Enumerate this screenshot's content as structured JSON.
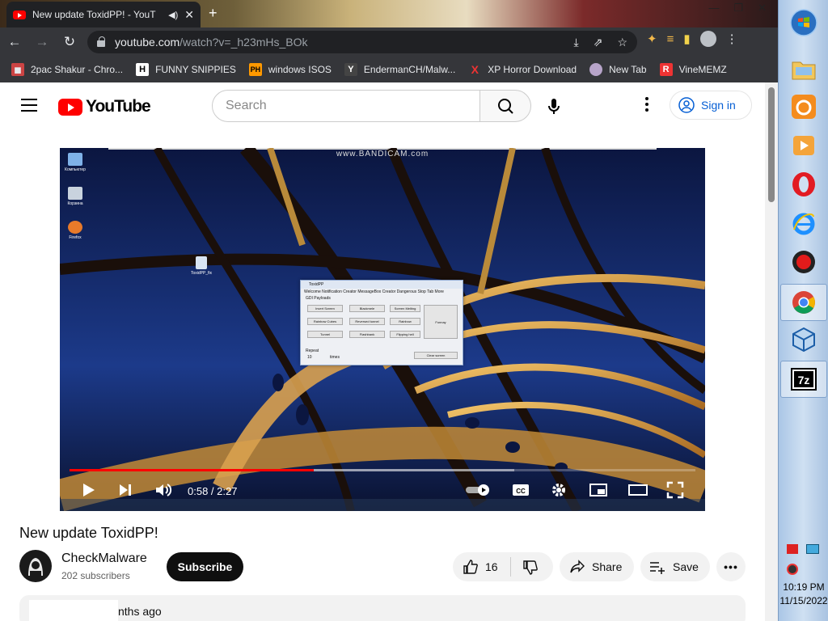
{
  "tab": {
    "title": "New update ToxidPP! - YouT"
  },
  "address": {
    "host": "youtube.com",
    "path": "/watch?v=_h23mHs_BOk"
  },
  "bookmarks": [
    {
      "label": "2pac Shakur - Chro...",
      "icon_text": ""
    },
    {
      "label": "FUNNY SNIPPIES",
      "icon_text": "H"
    },
    {
      "label": "windows ISOS",
      "icon_text": "PH"
    },
    {
      "label": "EndermanCH/Malw...",
      "icon_text": "Y"
    },
    {
      "label": "XP Horror Download",
      "icon_text": "X"
    },
    {
      "label": "New Tab",
      "icon_text": ""
    },
    {
      "label": "VineMEMZ",
      "icon_text": "R"
    }
  ],
  "youtube": {
    "logo_text": "YouTube",
    "search_placeholder": "Search",
    "signin_label": "Sign in"
  },
  "video": {
    "overlay_text": "www.BANDICAM.com",
    "time": "0:58 / 2:27",
    "progress_fraction": 0.39,
    "buffer_fraction": 0.71,
    "title": "New update ToxidPP!",
    "dialog": {
      "title": "ToxidPP",
      "tabs": "Welcome   Notification Creator   MessageBox Creator   Dangerous   Stop Tab   More",
      "section": "GDI Payloads",
      "buttons": [
        "Invert Screen",
        "Blackmele",
        "Screen Melting",
        "Rainbow Cubes",
        "Reversed tunnel",
        "Rainbow",
        "Tunnel",
        "Flashbank",
        "Flipping hell",
        "Funnay",
        "Clear screen"
      ],
      "repeat_label": "Repeat",
      "repeat_value": "10",
      "repeat_unit": "times"
    },
    "desktop_icons": [
      "Компьютер",
      "Корзина",
      "Firefox",
      "ToxidPP_fix"
    ]
  },
  "channel": {
    "name": "CheckMalware",
    "subscribers": "202 subscribers",
    "subscribe_label": "Subscribe"
  },
  "actions": {
    "likes": "16",
    "share_label": "Share",
    "save_label": "Save"
  },
  "description": {
    "partial_text": "nths ago"
  },
  "taskbar": {
    "time": "10:19 PM",
    "date": "11/15/2022"
  },
  "colors": {
    "yt_red": "#ff0000",
    "chrome_dark": "#35363a",
    "link_blue": "#065fd4"
  }
}
